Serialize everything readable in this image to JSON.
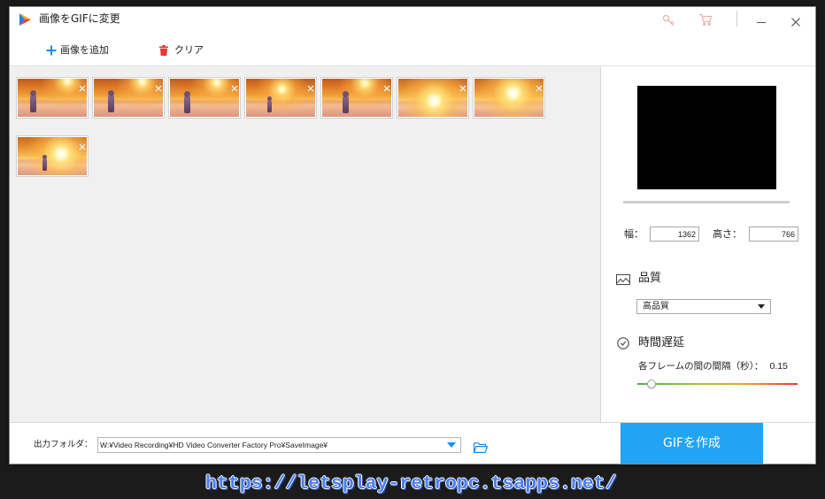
{
  "window": {
    "title": "画像をGIFに変更",
    "icons": {
      "app": "app-logo-icon",
      "key": "key-icon",
      "cart": "cart-icon",
      "minimize": "minimize-icon",
      "close": "close-icon"
    }
  },
  "toolbar": {
    "add_label": "画像を追加",
    "add_icon": "plus-icon",
    "clear_label": "クリア",
    "clear_icon": "trash-icon"
  },
  "image_list": {
    "remove_icon": "close-icon"
  },
  "settings": {
    "width_label": "幅：",
    "width_value": "1362",
    "height_label": "高さ：",
    "height_value": "766",
    "quality": {
      "icon": "image-icon",
      "label": "品質",
      "selected": "高品質"
    },
    "delay": {
      "icon": "clock-icon",
      "label": "時間遅延",
      "interval_label": "各フレームの間の間隔（秒）：",
      "value": "0.15",
      "slider_fraction": 0.09
    }
  },
  "output": {
    "label": "出力フォルダ：",
    "path": "W:¥Video Recording¥HD Video Converter Factory Pro¥SaveImage¥",
    "folder_icon": "folder-icon"
  },
  "create_button": "GIFを作成",
  "colors": {
    "accent": "#22a3f3",
    "add_icon": "#1a8ce8",
    "clear_icon": "#e53935",
    "slider_start": "#4cb34a",
    "slider_end": "#e23b35"
  },
  "watermark": "https://letsplay-retropc.tsapps.net/"
}
